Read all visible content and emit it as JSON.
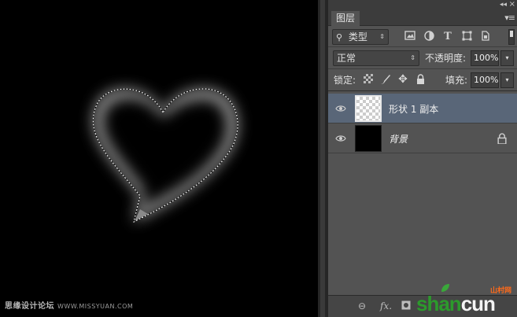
{
  "panel": {
    "tab_label": "图层",
    "menu_icon": "panel-menu-icon",
    "filter": {
      "label": "类型",
      "icons": [
        "image-filter-icon",
        "adjustment-filter-icon",
        "type-filter-icon",
        "shape-filter-icon",
        "smart-object-filter-icon"
      ]
    },
    "blend_mode": "正常",
    "opacity_label": "不透明度:",
    "opacity_value": "100%",
    "lock_label": "锁定:",
    "lock_icons": [
      "lock-transparent-icon",
      "lock-image-icon",
      "lock-position-icon",
      "lock-all-icon"
    ],
    "fill_label": "填充:",
    "fill_value": "100%",
    "layers": [
      {
        "name": "形状 1 副本",
        "selected": true,
        "visible": true,
        "thumbnail": "transparent"
      },
      {
        "name": "背景",
        "selected": false,
        "visible": true,
        "thumbnail": "black",
        "locked": true
      }
    ],
    "footer_icons": [
      "link-icon",
      "fx-icon",
      "mask-icon"
    ]
  },
  "watermarks": {
    "left_text": "思缘设计论坛",
    "left_url": "WWW.MISSYUAN.COM",
    "right_brand_1": "shan",
    "right_brand_2": "cun",
    "right_sub": "山村网"
  },
  "colors": {
    "canvas": "#000000",
    "panel": "#535353",
    "selected_layer": "#596678"
  }
}
